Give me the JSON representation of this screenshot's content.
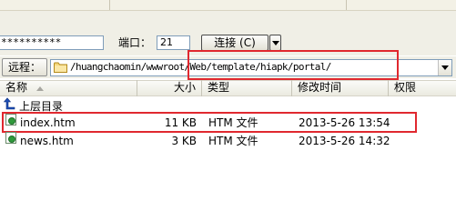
{
  "connection": {
    "password_value": "**********",
    "port_label": "端口：",
    "port_value": "21",
    "connect_label": "连接 (C)"
  },
  "remote": {
    "label": "远程：",
    "path": "/huangchaomin/wwwroot/Web/template/hiapk/portal/"
  },
  "columns": {
    "name": "名称",
    "size": "大小",
    "type": "类型",
    "modified": "修改时间",
    "permissions": "权限"
  },
  "parent_dir_label": "上层目录",
  "files": [
    {
      "name": "index.htm",
      "size": "11 KB",
      "type": "HTM 文件",
      "modified": "2013-5-26 13:54",
      "icon": "html-file-icon"
    },
    {
      "name": "news.htm",
      "size": "3 KB",
      "type": "HTM 文件",
      "modified": "2013-5-26 14:32",
      "icon": "html-file-icon"
    }
  ],
  "colors": {
    "highlight": "#e0282f",
    "window_bg": "#f0efe6"
  }
}
